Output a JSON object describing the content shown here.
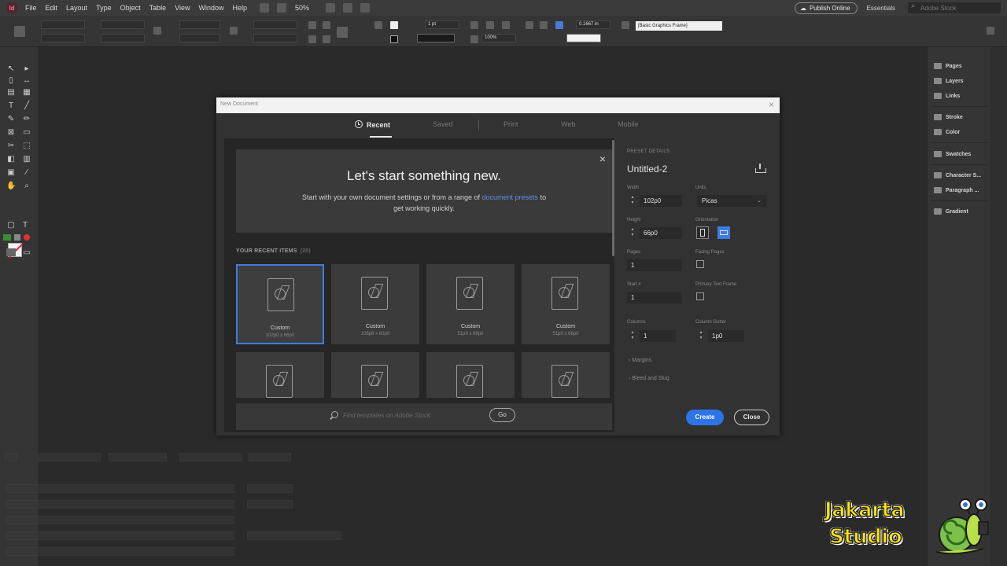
{
  "menu": {
    "logo": "Id",
    "items": [
      "File",
      "Edit",
      "Layout",
      "Type",
      "Object",
      "Table",
      "View",
      "Window",
      "Help"
    ],
    "zoom": "50%",
    "publish_label": "Publish Online",
    "workspace": "Essentials",
    "stock_search_placeholder": "Adobe Stock"
  },
  "controlbar": {
    "stroke_weight": "1 pt",
    "opacity": "100%",
    "measure": "0.1667 in",
    "frame_style": "[Basic Graphics Frame]"
  },
  "panels": {
    "items": [
      {
        "label": "Pages",
        "icon": "pages-icon"
      },
      {
        "label": "Layers",
        "icon": "layers-icon"
      },
      {
        "label": "Links",
        "icon": "links-icon"
      },
      {
        "label": "Stroke",
        "icon": "stroke-icon"
      },
      {
        "label": "Color",
        "icon": "color-icon"
      },
      {
        "label": "Swatches",
        "icon": "swatches-icon"
      },
      {
        "label": "Character S...",
        "icon": "character-styles-icon"
      },
      {
        "label": "Paragraph ...",
        "icon": "paragraph-styles-icon"
      },
      {
        "label": "Gradient",
        "icon": "gradient-icon"
      }
    ]
  },
  "dialog": {
    "title": "New Document",
    "tabs": {
      "recent": "Recent",
      "saved": "Saved",
      "print": "Print",
      "web": "Web",
      "mobile": "Mobile"
    },
    "hero": {
      "title": "Let's start something new.",
      "sub_before": "Start with your own document settings or from a range of ",
      "sub_link": "document presets",
      "sub_after": " to",
      "sub_line2": "get working quickly."
    },
    "recent_label": "YOUR RECENT ITEMS",
    "recent_count": "(20)",
    "recent_items": [
      {
        "name": "Custom",
        "size": "102p0 x 66p0"
      },
      {
        "name": "Custom",
        "size": "106p8 x 60p0"
      },
      {
        "name": "Custom",
        "size": "51p0 x 66p0"
      },
      {
        "name": "Custom",
        "size": "51p0 x 66p0"
      }
    ],
    "search_placeholder": "Find templates on Adobe Stock",
    "go_label": "Go",
    "preset": {
      "section_label": "PRESET DETAILS",
      "name": "Untitled-2",
      "width_label": "Width",
      "width_value": "102p0",
      "units_label": "Units",
      "units_value": "Picas",
      "height_label": "Height",
      "height_value": "66p0",
      "orientation_label": "Orientation",
      "pages_label": "Pages",
      "pages_value": "1",
      "facing_pages_label": "Facing Pages",
      "start_label": "Start #",
      "start_value": "1",
      "primary_text_label": "Primary Text Frame",
      "columns_label": "Columns",
      "columns_value": "1",
      "gutter_label": "Column Gutter",
      "gutter_value": "1p0",
      "margins_label": "Margins",
      "bleed_label": "Bleed and Slug",
      "create_label": "Create",
      "close_label": "Close"
    }
  },
  "watermark": {
    "line1": "Jakarta",
    "line2": "Studio"
  },
  "colors": {
    "accent_blue": "#2d74e8",
    "selected_border": "#3d7ce0",
    "link": "#5a8fe0",
    "watermark_yellow": "#ffe600"
  }
}
